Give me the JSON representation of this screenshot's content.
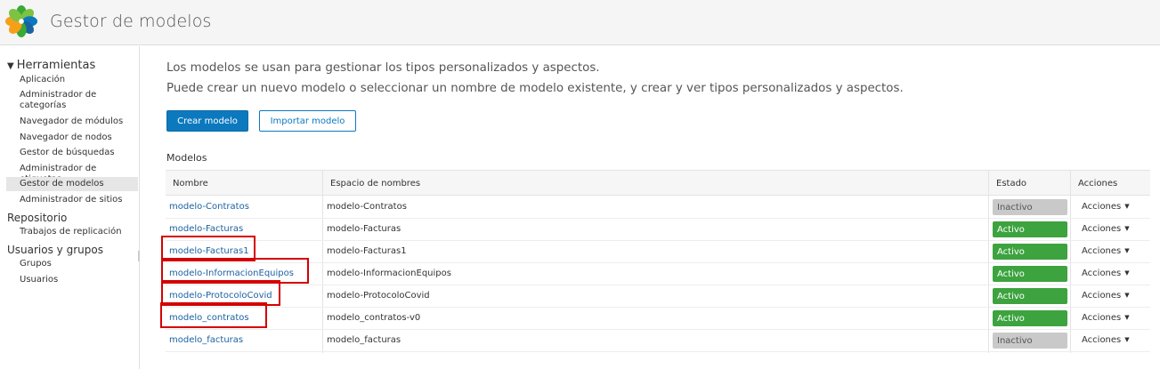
{
  "header": {
    "title": "Gestor de modelos",
    "colors": {
      "logo": [
        "#3aa935",
        "#0c79bf",
        "#f6a01a",
        "#7dc243",
        "#1b62a2"
      ]
    }
  },
  "sidebar": {
    "groups": [
      {
        "title": "Herramientas",
        "expanded": true,
        "items": [
          "Aplicación",
          "Administrador de categorías",
          "Navegador de módulos",
          "Navegador de nodos",
          "Gestor de búsquedas",
          "Administrador de etiquetas",
          "Gestor de modelos",
          "Administrador de sitios"
        ],
        "selected_index": 6
      },
      {
        "title": "Repositorio",
        "items": [
          "Trabajos de replicación"
        ]
      },
      {
        "title": "Usuarios y grupos",
        "items": [
          "Grupos",
          "Usuarios"
        ]
      }
    ]
  },
  "main": {
    "intro_line1": "Los modelos se usan para gestionar los tipos personalizados y aspectos.",
    "intro_line2": "Puede crear un nuevo modelo o seleccionar un nombre de modelo existente, y crear y ver tipos personalizados y aspectos.",
    "create_button": "Crear modelo",
    "import_button": "Importar modelo",
    "section_title": "Modelos",
    "table": {
      "headers": {
        "name": "Nombre",
        "namespace": "Espacio de nombres",
        "status": "Estado",
        "actions": "Acciones"
      },
      "rows": [
        {
          "name": "modelo-Contratos",
          "namespace": "modelo-Contratos",
          "status": "Inactivo",
          "active": false,
          "actions": "Acciones",
          "highlighted": false
        },
        {
          "name": "modelo-Facturas",
          "namespace": "modelo-Facturas",
          "status": "Activo",
          "active": true,
          "actions": "Acciones",
          "highlighted": false
        },
        {
          "name": "modelo-Facturas1",
          "namespace": "modelo-Facturas1",
          "status": "Activo",
          "active": true,
          "actions": "Acciones",
          "highlighted": true
        },
        {
          "name": "modelo-InformacionEquipos",
          "namespace": "modelo-InformacionEquipos",
          "status": "Activo",
          "active": true,
          "actions": "Acciones",
          "highlighted": true
        },
        {
          "name": "modelo-ProtocoloCovid",
          "namespace": "modelo-ProtocoloCovid",
          "status": "Activo",
          "active": true,
          "actions": "Acciones",
          "highlighted": true
        },
        {
          "name": "modelo_contratos",
          "namespace": "modelo_contratos-v0",
          "status": "Activo",
          "active": true,
          "actions": "Acciones",
          "highlighted": true
        },
        {
          "name": "modelo_facturas",
          "namespace": "modelo_facturas",
          "status": "Inactivo",
          "active": false,
          "actions": "Acciones",
          "highlighted": false
        }
      ]
    },
    "colors": {
      "primary": "#0c79bf",
      "link": "#1b62a2",
      "active": "#3da33f",
      "inactive": "#c9c9c9",
      "highlight": "#d40000"
    }
  }
}
